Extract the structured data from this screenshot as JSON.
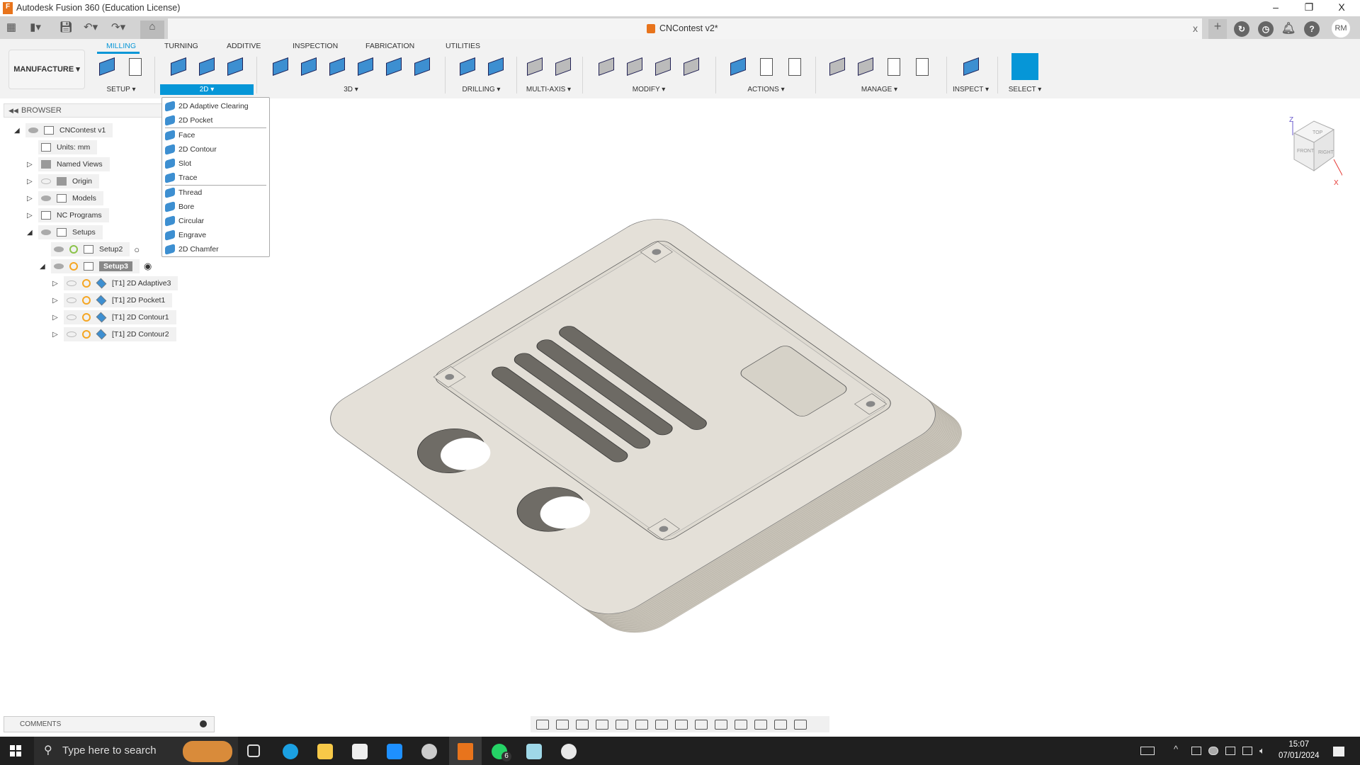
{
  "window": {
    "title": "Autodesk Fusion 360 (Education License)",
    "minimize": "–",
    "restore": "❐",
    "close": "X"
  },
  "document": {
    "tab_name": "CNContest v2*",
    "close": "x",
    "user_initials": "RM"
  },
  "workspace": {
    "label": "MANUFACTURE ▾"
  },
  "tabs": [
    {
      "label": "MILLING",
      "active": true
    },
    {
      "label": "TURNING"
    },
    {
      "label": "ADDITIVE"
    },
    {
      "label": "INSPECTION"
    },
    {
      "label": "FABRICATION"
    },
    {
      "label": "UTILITIES"
    }
  ],
  "groups": [
    {
      "label": "SETUP ▾",
      "icons": [
        "setup-icon",
        "nc-program-icon"
      ]
    },
    {
      "label": "2D ▾",
      "active": true,
      "icons": [
        "2d-adaptive-icon",
        "2d-pocket-icon",
        "2d-contour-icon"
      ]
    },
    {
      "label": "3D ▾",
      "icons": [
        "adaptive-icon",
        "pocket-clearing-icon",
        "steep-shallow-icon",
        "flow-icon",
        "radial-icon",
        "scallop-icon"
      ]
    },
    {
      "label": "DRILLING ▾",
      "icons": [
        "drill-icon",
        "hole-recognition-icon"
      ]
    },
    {
      "label": "MULTI-AXIS ▾",
      "icons": [
        "multi-axis-contour-icon",
        "swarf-icon"
      ]
    },
    {
      "label": "MODIFY ▾",
      "icons": [
        "trim-icon",
        "delete-icon",
        "tool-orientation-icon",
        "pattern-icon"
      ]
    },
    {
      "label": "ACTIONS ▾",
      "icons": [
        "simulate-icon",
        "post-process-icon",
        "setup-sheet-icon"
      ]
    },
    {
      "label": "MANAGE ▾",
      "icons": [
        "tool-library-icon",
        "machine-library-icon",
        "post-library-icon",
        "template-library-icon"
      ]
    },
    {
      "label": "INSPECT ▾",
      "icons": [
        "measure-icon"
      ]
    },
    {
      "label": "SELECT ▾",
      "icons": [
        "select-icon"
      ]
    }
  ],
  "browser": {
    "title": "BROWSER",
    "items": [
      {
        "label": "CNContest v1",
        "level": 0,
        "expand": "◢",
        "eye": "on",
        "icon": "component"
      },
      {
        "label": "Units: mm",
        "level": 1,
        "expand": "",
        "icon": "units"
      },
      {
        "label": "Named Views",
        "level": 1,
        "expand": "▷",
        "icon": "folder"
      },
      {
        "label": "Origin",
        "level": 1,
        "expand": "▷",
        "eye": "off",
        "icon": "folder"
      },
      {
        "label": "Models",
        "level": 1,
        "expand": "▷",
        "eye": "on",
        "icon": "component"
      },
      {
        "label": "NC Programs",
        "level": 1,
        "expand": "▷",
        "icon": "nc"
      },
      {
        "label": "Setups",
        "level": 1,
        "expand": "◢",
        "eye": "on",
        "icon": "setup"
      },
      {
        "label": "Setup2",
        "level": 2,
        "expand": "",
        "eye": "on",
        "status": "#8bc34a",
        "icon": "setup",
        "radio": "○"
      },
      {
        "label": "Setup3",
        "level": 2,
        "expand": "◢",
        "eye": "on",
        "status": "#f5a623",
        "icon": "setup",
        "radio": "◉",
        "highlight": true
      },
      {
        "label": "[T1] 2D Adaptive3",
        "level": 3,
        "expand": "▷",
        "eye": "off",
        "status": "#f5a623",
        "icon": "op"
      },
      {
        "label": "[T1] 2D Pocket1",
        "level": 3,
        "expand": "▷",
        "eye": "off",
        "status": "#f5a623",
        "icon": "op"
      },
      {
        "label": "[T1] 2D Contour1",
        "level": 3,
        "expand": "▷",
        "eye": "off",
        "status": "#f5a623",
        "icon": "op"
      },
      {
        "label": "[T1] 2D Contour2",
        "level": 3,
        "expand": "▷",
        "eye": "off",
        "status": "#f5a623",
        "icon": "op"
      }
    ]
  },
  "menu_2d": {
    "sections": [
      [
        "2D Adaptive Clearing",
        "2D Pocket"
      ],
      [
        "Face",
        "2D Contour",
        "Slot",
        "Trace"
      ],
      [
        "Thread",
        "Bore",
        "Circular",
        "Engrave",
        "2D Chamfer"
      ]
    ]
  },
  "viewcube": {
    "top": "TOP",
    "front": "FRONT",
    "right": "RIGHT",
    "z": "Z",
    "x": "X"
  },
  "comments": {
    "label": "COMMENTS"
  },
  "taskbar": {
    "search_placeholder": "Type here to search",
    "time": "15:07",
    "date": "07/01/2024",
    "whatsapp_badge": "6"
  },
  "colors": {
    "accent": "#0696d7",
    "model_top": "#e4e0d8",
    "model_side": "#c9c4b9"
  }
}
